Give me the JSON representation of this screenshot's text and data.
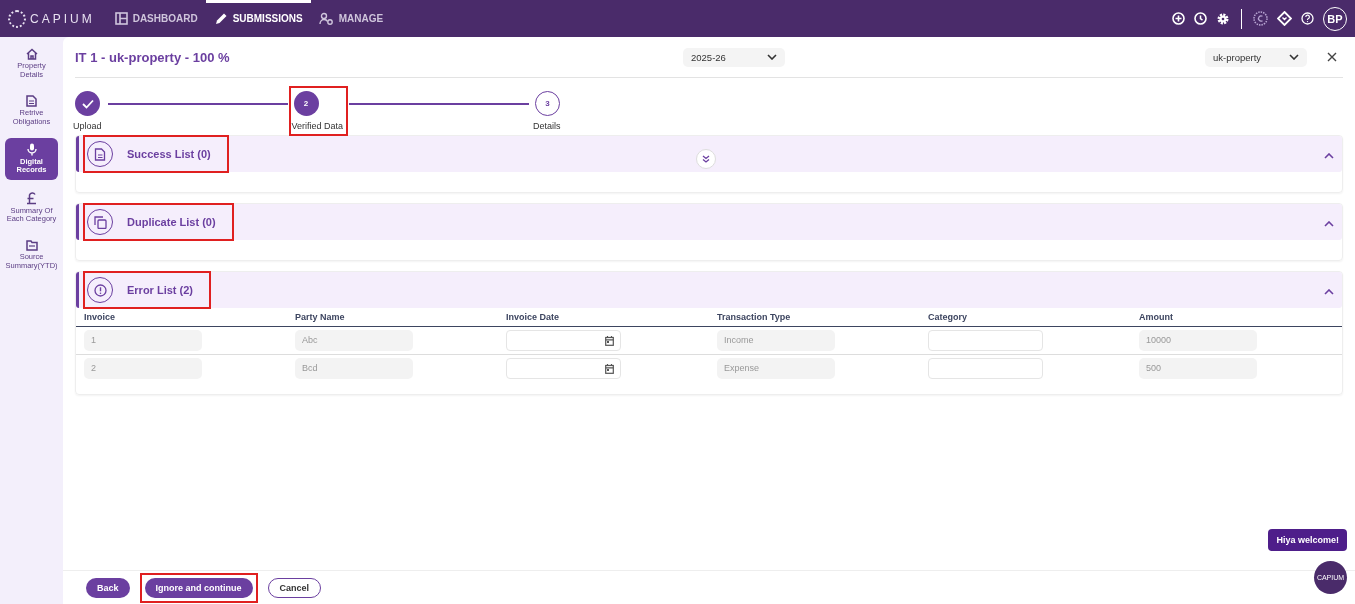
{
  "nav": {
    "logo": "CAPIUM",
    "avatar": "BP",
    "items": [
      {
        "label": "DASHBOARD",
        "kind": "grid",
        "selected": false
      },
      {
        "label": "SUBMISSIONS",
        "kind": "pencil",
        "selected": true
      },
      {
        "label": "MANAGE",
        "kind": "people",
        "selected": false
      }
    ]
  },
  "sidebar": {
    "items": [
      {
        "label": "Property Details",
        "kind": "home",
        "selected": false
      },
      {
        "label": "Retrive Obligations",
        "kind": "doc",
        "selected": false
      },
      {
        "label": "Digital Records",
        "kind": "mic",
        "selected": true
      },
      {
        "label": "Summary Of Each Category",
        "kind": "pound",
        "selected": false
      },
      {
        "label": "Source Summary(YTD)",
        "kind": "folder",
        "selected": false
      }
    ]
  },
  "header": {
    "title": "IT 1 - uk-property - 100 %",
    "year": "2025-26",
    "source": "uk-property"
  },
  "stepper": [
    {
      "label": "Upload",
      "kind": "done",
      "highlighted": false
    },
    {
      "number": "2",
      "label": "Verified Data",
      "kind": "current",
      "highlighted": true
    },
    {
      "number": "3",
      "label": "Details",
      "kind": "pending",
      "highlighted": false
    }
  ],
  "sections": [
    {
      "title": "Success List (0)",
      "kind": "document",
      "expanded": true,
      "highlighted": true
    },
    {
      "title": "Duplicate List (0)",
      "kind": "copy",
      "expanded": true,
      "highlighted": true
    },
    {
      "title": "Error List (2)",
      "kind": "alert",
      "expanded": true,
      "highlighted": true,
      "table": {
        "columns": [
          "Invoice",
          "Party Name",
          "Invoice Date",
          "Transaction Type",
          "Category",
          "Amount"
        ],
        "rows": [
          [
            {
              "kind": "readonly",
              "value": "1"
            },
            {
              "kind": "readonly",
              "value": "Abc"
            },
            {
              "kind": "date"
            },
            {
              "kind": "readonly",
              "value": "Income"
            },
            {
              "kind": "input"
            },
            {
              "kind": "readonly",
              "value": "10000"
            }
          ],
          [
            {
              "kind": "readonly",
              "value": "2"
            },
            {
              "kind": "readonly",
              "value": "Bcd"
            },
            {
              "kind": "date"
            },
            {
              "kind": "readonly",
              "value": "Expense"
            },
            {
              "kind": "input"
            },
            {
              "kind": "readonly",
              "value": "500"
            }
          ]
        ]
      }
    }
  ],
  "footer": {
    "buttons": [
      {
        "label": "Back",
        "kind": "primary",
        "highlighted": false
      },
      {
        "label": "Ignore and continue",
        "kind": "primary",
        "highlighted": true
      },
      {
        "label": "Cancel",
        "kind": "outline",
        "highlighted": false
      }
    ]
  },
  "chat": {
    "bubble": "Hiya welcome!",
    "launcher": "CAPIUM"
  }
}
